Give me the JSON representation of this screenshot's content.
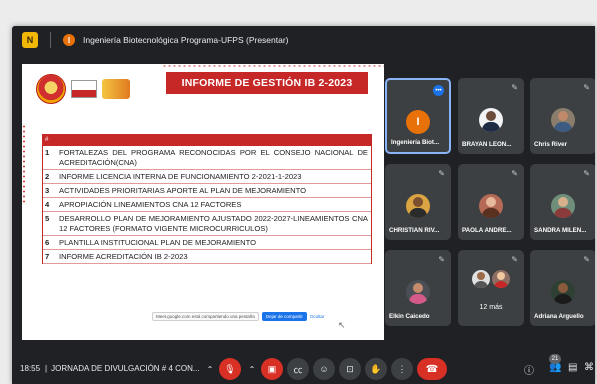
{
  "topbar": {
    "app_badge": "N",
    "presenter_initial": "I",
    "presenter_label": "Ingeniería Biotecnológica Programa-UFPS (Presentar)"
  },
  "slide": {
    "title": "INFORME DE GESTIÓN IB 2-2023",
    "table_head": "#",
    "rows": [
      {
        "num": "1",
        "text": "FORTALEZAS DEL PROGRAMA RECONOCIDAS POR EL CONSEJO NACIONAL DE ACREDITACIÓN(CNA)"
      },
      {
        "num": "2",
        "text": "INFORME LICENCIA INTERNA DE FUNCIONAMIENTO 2-2021-1-2023"
      },
      {
        "num": "3",
        "text": "ACTIVIDADES PRIORITARIAS APORTE AL PLAN DE MEJORAMIENTO"
      },
      {
        "num": "4",
        "text": "APROPIACIÓN LINEAMIENTOS CNA 12 FACTORES"
      },
      {
        "num": "5",
        "text": "DESARROLLO PLAN DE MEJORAMIENTO AJUSTADO 2022-2027-LINEAMIENTOS CNA 12 FACTORES (FORMATO VIGENTE MICROCURRICULOS)"
      },
      {
        "num": "6",
        "text": "PLANTILLA INSTITUCIONAL PLAN DE MEJORAMIENTO"
      },
      {
        "num": "7",
        "text": "INFORME ACREDITACIÓN IB 2-2023"
      }
    ],
    "share_bar": {
      "text": "Meet.google.com está compartiendo una pestaña",
      "stop_label": "Dejar de compartir",
      "hide_label": "Ocultar"
    }
  },
  "participants": {
    "tiles": [
      {
        "name": "Ingeniería Biot...",
        "initial": "I"
      },
      {
        "name": "BRAYAN LEON..."
      },
      {
        "name": "Chris River"
      },
      {
        "name": "CHRISTIAN RIV..."
      },
      {
        "name": "PAOLA ANDRE..."
      },
      {
        "name": "SANDRA MILEN..."
      },
      {
        "name": "Elkin Caicedo"
      },
      {
        "name": "12 más"
      },
      {
        "name": "Adriana Arguello"
      }
    ]
  },
  "bottombar": {
    "time": "18:55",
    "separator": "|",
    "meeting_name": "JORNADA DE DIVULGACIÓN # 4 CON...",
    "participant_count": "21"
  },
  "colors": {
    "window_bg": "#202124",
    "tile_bg": "#3c4043",
    "accent_red": "#c62828",
    "end_call": "#d93025",
    "active_border": "#8ab4f8"
  },
  "icons": [
    "mic-off-icon",
    "camera-off-icon",
    "captions-icon",
    "emoji-icon",
    "present-icon",
    "raise-hand-icon",
    "more-icon",
    "end-call-icon",
    "info-icon",
    "people-icon",
    "chat-icon",
    "activities-icon"
  ]
}
